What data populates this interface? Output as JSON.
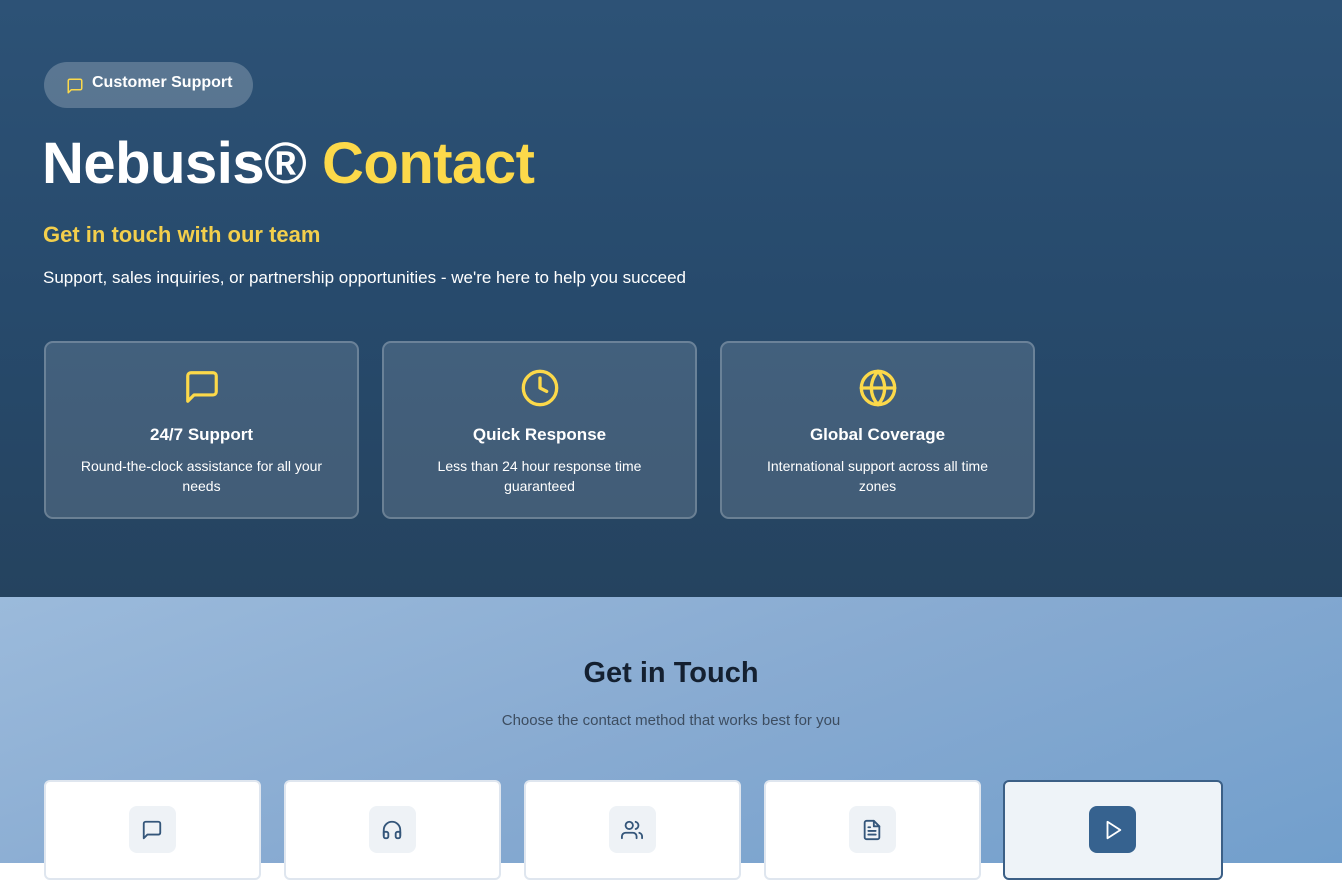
{
  "colors": {
    "accent": "#fcd94a",
    "hero_bg": "#2a4d70",
    "lower_bg": "#8aaed4",
    "active_icon_bg": "#36628f"
  },
  "badge": {
    "icon": "message-square-icon",
    "label": "Customer Support"
  },
  "hero": {
    "title_main": "Nebusis®",
    "title_accent": "Contact",
    "subtitle": "Get in touch with our team",
    "description": "Support, sales inquiries, or partnership opportunities - we're here to help you succeed"
  },
  "features": [
    {
      "icon": "message-square-icon",
      "title": "24/7 Support",
      "description": "Round-the-clock assistance for all your needs"
    },
    {
      "icon": "clock-icon",
      "title": "Quick Response",
      "description": "Less than 24 hour response time guaranteed"
    },
    {
      "icon": "globe-icon",
      "title": "Global Coverage",
      "description": "International support across all time zones"
    }
  ],
  "contact_section": {
    "title": "Get in Touch",
    "subtitle": "Choose the contact method that works best for you",
    "methods": [
      {
        "icon": "message-square-icon",
        "active": false
      },
      {
        "icon": "headphones-icon",
        "active": false
      },
      {
        "icon": "users-icon",
        "active": false
      },
      {
        "icon": "file-text-icon",
        "active": false
      },
      {
        "icon": "play-icon",
        "active": true
      }
    ]
  }
}
